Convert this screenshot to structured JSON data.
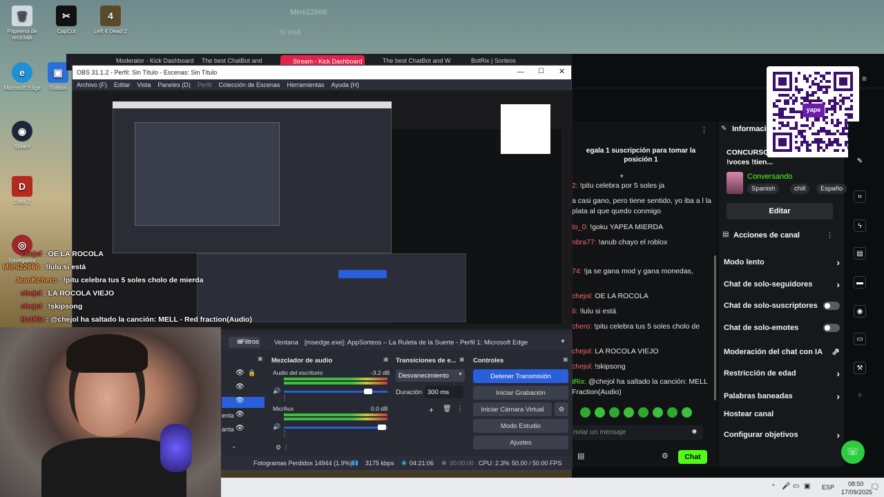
{
  "desktop": {
    "icons": [
      {
        "label": "Papelera de reciclaje"
      },
      {
        "label": "CapCut"
      },
      {
        "label": "Left 4 Dead 2"
      },
      {
        "label": "Microsoft Edge"
      },
      {
        "label": "Roblox"
      },
      {
        "label": "Steam"
      },
      {
        "label": "Dota 2"
      },
      {
        "label": "Navegador"
      }
    ]
  },
  "browser_tabs": [
    "Moderator - Kick Dashboard",
    "The best ChatBot and",
    "Stream - Kick Dashboard",
    "The best ChatBot and W",
    "BotRix | Sorteos"
  ],
  "obs": {
    "title": "OBS 31.1.2 - Perfil: Sin Título - Escenas: Sin Título",
    "menu": [
      "Archivo (F)",
      "Editar",
      "Vista",
      "Paneles (D)",
      "Perfil",
      "Colección de Escenas",
      "Herramientas",
      "Ayuda (H)"
    ],
    "filtros": "Filtros",
    "ventana_label": "Ventana",
    "ventana_value": "[msedge.exe]: AppSorteos – La Ruleta de la Suerte - Perfil 1: Microsoft Edge",
    "mixer_title": "Mezclador de audio",
    "mixer": [
      {
        "name": "Audio del escritorio",
        "db": "-3.2 dB"
      },
      {
        "name": "Mic/Aux",
        "db": "0.0 dB"
      }
    ],
    "transitions_title": "Transiciones de e...",
    "transition": "Desvanecimiento",
    "duration_label": "Duración",
    "duration_value": "300 ms",
    "controls_title": "Controles",
    "controls": [
      "Detener Transmisión",
      "Iniciar Grabación",
      "Iniciar Cámara Virtual",
      "Modo Estudio",
      "Ajustes"
    ],
    "scene_items": [
      "enta",
      "anta"
    ],
    "status": {
      "dropped": "Fotogramas Perdidos 14944 (1.9%)",
      "kbps": "3175 kbps",
      "live": "04:21:06",
      "rec": "00:00:00",
      "cpu": "CPU: 2.3%",
      "fps": "50.00 / 50.00 FPS"
    }
  },
  "kick": {
    "chat_header": "egala 1 suscripción para tomar la posición 1",
    "chat": [
      {
        "user": "2:",
        "text": " !pitu celebra por 5 soles ja"
      },
      {
        "user": "",
        "text": "a casi gano, pero tiene sentido, yo iba a l la plata al que quedo conmigo"
      },
      {
        "user": "to_0:",
        "text": " !goku YAPEA MIERDA"
      },
      {
        "user": "nbra77:",
        "text": " !anub chayo el roblox"
      },
      {
        "user": "74:",
        "text": " !ja se gana mod y gana monedas,"
      },
      {
        "user": "chejol:",
        "text": " OE LA ROCOLA"
      },
      {
        "user": "6:",
        "text": " !lulu si está"
      },
      {
        "user": "chero:",
        "text": " !pitu celebra tus 5 soles cholo de"
      },
      {
        "user": "chejol:",
        "text": " LA ROCOLA VIEJO"
      },
      {
        "user": "chejol:",
        "text": " !skipsong"
      },
      {
        "user": "tRix:",
        "text": " @chejol ha saltado la canción: MELL Fraction(Audio)"
      }
    ],
    "message_placeholder": "nviar un mensaje",
    "chat_button": "Chat",
    "info_title": "Informaci",
    "stream_title": "CONCURSO MAS FEO! !wtsp !voces !tien...",
    "status": "Conversando",
    "tags": [
      "Spanish",
      "chill",
      "Españo"
    ],
    "edit_button": "Editar",
    "actions_title": "Acciones de canal",
    "actions": [
      {
        "label": "Modo lento",
        "kind": "arrow"
      },
      {
        "label": "Chat de solo-seguidores",
        "kind": "arrow"
      },
      {
        "label": "Chat de solo-suscriptores",
        "kind": "toggle"
      },
      {
        "label": "Chat de solo-emotes",
        "kind": "toggle"
      },
      {
        "label": "Moderación del chat con IA",
        "kind": "ext"
      },
      {
        "label": "Restricción de edad",
        "kind": "arrow"
      },
      {
        "label": "Palabras baneadas",
        "kind": "arrow"
      },
      {
        "label": "Hostear canal",
        "kind": "none"
      },
      {
        "label": "Configurar objetivos",
        "kind": "arrow"
      }
    ],
    "qr_brand": "yape"
  },
  "overlay_chat": [
    {
      "user": "chejol",
      "text": " : OE LA ROCOLA"
    },
    {
      "user": "Mimi22666",
      "text": " : !lulu si está"
    },
    {
      "user": "JeanKchero",
      "text": " : !pitu celebra tus 5 soles cholo de mierda"
    },
    {
      "user": "chejol",
      "text": " : LA ROCOLA VIEJO"
    },
    {
      "user": "chejol",
      "text": " : !skipsong"
    },
    {
      "user": "BotRix",
      "text": " : @chejol ha saltado la canción: MELL - Red fraction(Audio)"
    }
  ],
  "taskbar": {
    "lang": "ESP",
    "time": "08:50",
    "date": "17/09/2025"
  },
  "colors": {
    "kick_green": "#53fc18",
    "obs_blue": "#2a5fd9"
  }
}
